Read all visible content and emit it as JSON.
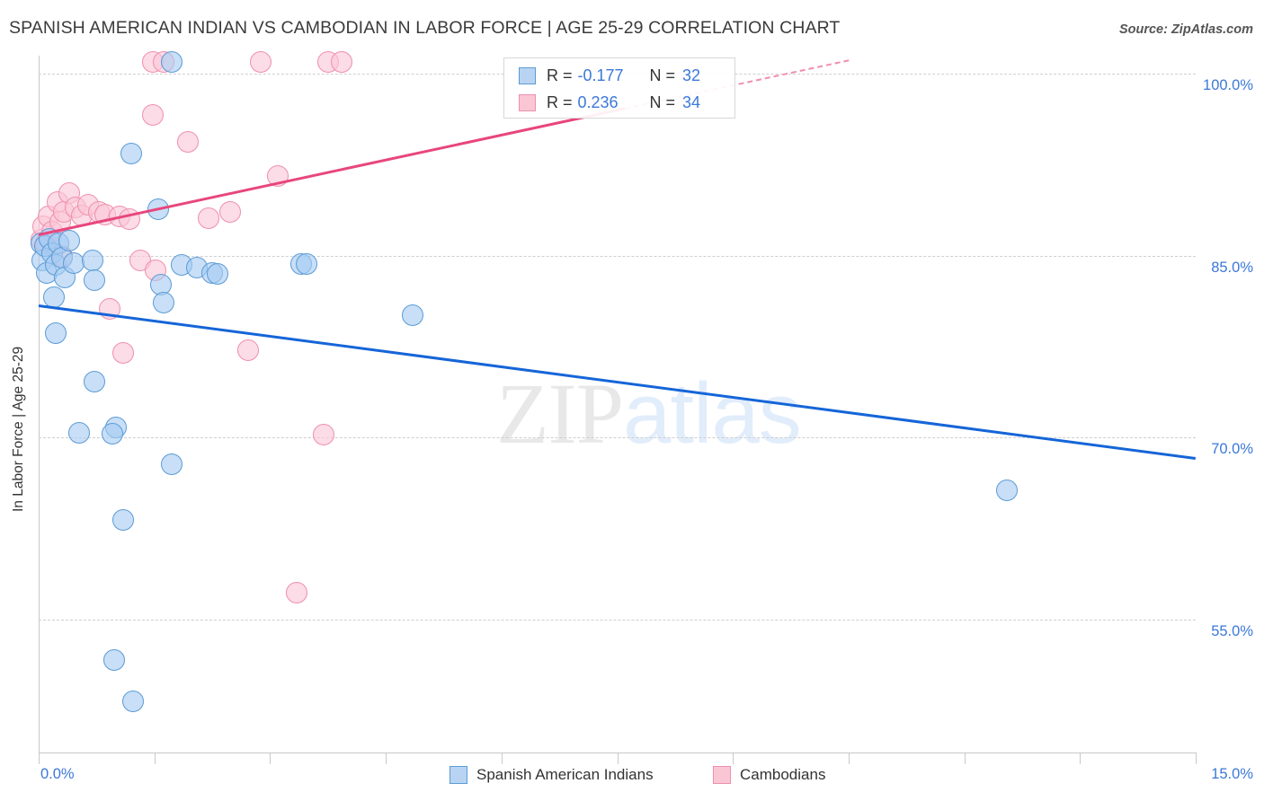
{
  "header": {
    "title": "SPANISH AMERICAN INDIAN VS CAMBODIAN IN LABOR FORCE | AGE 25-29 CORRELATION CHART",
    "source": "Source: ZipAtlas.com"
  },
  "watermark": {
    "part1": "ZIP",
    "part2": "atlas"
  },
  "stats": {
    "blue": {
      "r_label": "R =",
      "r_value": "-0.177",
      "n_label": "N =",
      "n_value": "32"
    },
    "pink": {
      "r_label": "R =",
      "r_value": "0.236",
      "n_label": "N =",
      "n_value": "34"
    }
  },
  "bottom_legend": [
    {
      "label": "Spanish American Indians",
      "color": "#b9d4f2"
    },
    {
      "label": "Cambodians",
      "color": "#fac6d6"
    }
  ],
  "chart_data": {
    "type": "scatter",
    "title": "SPANISH AMERICAN INDIAN VS CAMBODIAN IN LABOR FORCE | AGE 25-29 CORRELATION CHART",
    "xlabel": "",
    "ylabel": "In Labor Force | Age 25-29",
    "xlim": [
      0.0,
      15.0
    ],
    "ylim": [
      44.0,
      101.5
    ],
    "x_tick_labels": [
      "0.0%",
      "15.0%"
    ],
    "y_tick_labels": [
      "100.0%",
      "85.0%",
      "70.0%",
      "55.0%"
    ],
    "y_ticks": [
      100.0,
      85.0,
      70.0,
      55.0
    ],
    "grid": true,
    "legend_position": "bottom",
    "series": [
      {
        "name": "Spanish American Indians",
        "color": "#b9d4f2",
        "edge_color": "#5b9bd5",
        "r": -0.177,
        "n": 32,
        "trendline": {
          "x0": 0.0,
          "y0": 81.0,
          "x1": 15.0,
          "y1": 68.4,
          "style": "solid"
        },
        "points": [
          {
            "x": 0.04,
            "y": 86.0
          },
          {
            "x": 0.05,
            "y": 84.6
          },
          {
            "x": 0.08,
            "y": 85.8
          },
          {
            "x": 0.1,
            "y": 83.6
          },
          {
            "x": 0.14,
            "y": 86.4
          },
          {
            "x": 0.18,
            "y": 85.2
          },
          {
            "x": 0.22,
            "y": 84.2
          },
          {
            "x": 0.26,
            "y": 86.0
          },
          {
            "x": 0.3,
            "y": 84.8
          },
          {
            "x": 0.34,
            "y": 83.2
          },
          {
            "x": 0.4,
            "y": 86.2
          },
          {
            "x": 0.46,
            "y": 84.4
          },
          {
            "x": 0.2,
            "y": 81.6
          },
          {
            "x": 0.22,
            "y": 78.6
          },
          {
            "x": 0.7,
            "y": 84.6
          },
          {
            "x": 0.72,
            "y": 83.0
          },
          {
            "x": 1.2,
            "y": 93.4
          },
          {
            "x": 1.55,
            "y": 88.8
          },
          {
            "x": 1.58,
            "y": 82.6
          },
          {
            "x": 1.62,
            "y": 81.1
          },
          {
            "x": 1.85,
            "y": 84.2
          },
          {
            "x": 2.05,
            "y": 84.0
          },
          {
            "x": 2.25,
            "y": 83.6
          },
          {
            "x": 2.32,
            "y": 83.5
          },
          {
            "x": 0.72,
            "y": 74.6
          },
          {
            "x": 0.52,
            "y": 70.4
          },
          {
            "x": 1.0,
            "y": 70.8
          },
          {
            "x": 0.95,
            "y": 70.3
          },
          {
            "x": 1.72,
            "y": 67.8
          },
          {
            "x": 1.1,
            "y": 63.2
          },
          {
            "x": 3.4,
            "y": 84.3
          },
          {
            "x": 3.47,
            "y": 84.3
          },
          {
            "x": 4.85,
            "y": 80.1
          },
          {
            "x": 0.98,
            "y": 51.6
          },
          {
            "x": 1.22,
            "y": 48.2
          },
          {
            "x": 12.55,
            "y": 65.6
          },
          {
            "x": 1.73,
            "y": 101.0
          }
        ]
      },
      {
        "name": "Cambodians",
        "color": "#fac6d6",
        "edge_color": "#ef8fad",
        "r": 0.236,
        "n": 34,
        "trendline": {
          "x0": 0.0,
          "y0": 86.8,
          "x1": 10.5,
          "y1": 101.2,
          "style": "solid-then-dashed",
          "dash_start_x": 7.6
        },
        "points": [
          {
            "x": 0.03,
            "y": 86.3
          },
          {
            "x": 0.06,
            "y": 87.4
          },
          {
            "x": 0.09,
            "y": 86.0
          },
          {
            "x": 0.13,
            "y": 88.2
          },
          {
            "x": 0.17,
            "y": 87.0
          },
          {
            "x": 0.24,
            "y": 89.4
          },
          {
            "x": 0.28,
            "y": 87.8
          },
          {
            "x": 0.33,
            "y": 88.6
          },
          {
            "x": 0.4,
            "y": 90.2
          },
          {
            "x": 0.48,
            "y": 89.0
          },
          {
            "x": 0.56,
            "y": 88.3
          },
          {
            "x": 0.64,
            "y": 89.2
          },
          {
            "x": 0.78,
            "y": 88.6
          },
          {
            "x": 0.86,
            "y": 88.4
          },
          {
            "x": 1.05,
            "y": 88.2
          },
          {
            "x": 1.18,
            "y": 88.0
          },
          {
            "x": 1.32,
            "y": 84.6
          },
          {
            "x": 1.52,
            "y": 83.8
          },
          {
            "x": 2.2,
            "y": 88.1
          },
          {
            "x": 2.48,
            "y": 88.6
          },
          {
            "x": 1.48,
            "y": 96.6
          },
          {
            "x": 1.93,
            "y": 94.4
          },
          {
            "x": 3.1,
            "y": 91.6
          },
          {
            "x": 1.48,
            "y": 101.0
          },
          {
            "x": 1.62,
            "y": 101.0
          },
          {
            "x": 2.88,
            "y": 101.0
          },
          {
            "x": 3.75,
            "y": 101.0
          },
          {
            "x": 3.93,
            "y": 101.0
          },
          {
            "x": 0.92,
            "y": 80.6
          },
          {
            "x": 1.1,
            "y": 77.0
          },
          {
            "x": 2.72,
            "y": 77.2
          },
          {
            "x": 3.7,
            "y": 70.2
          },
          {
            "x": 3.35,
            "y": 57.2
          },
          {
            "x": 0.3,
            "y": 85.0
          }
        ]
      }
    ]
  }
}
